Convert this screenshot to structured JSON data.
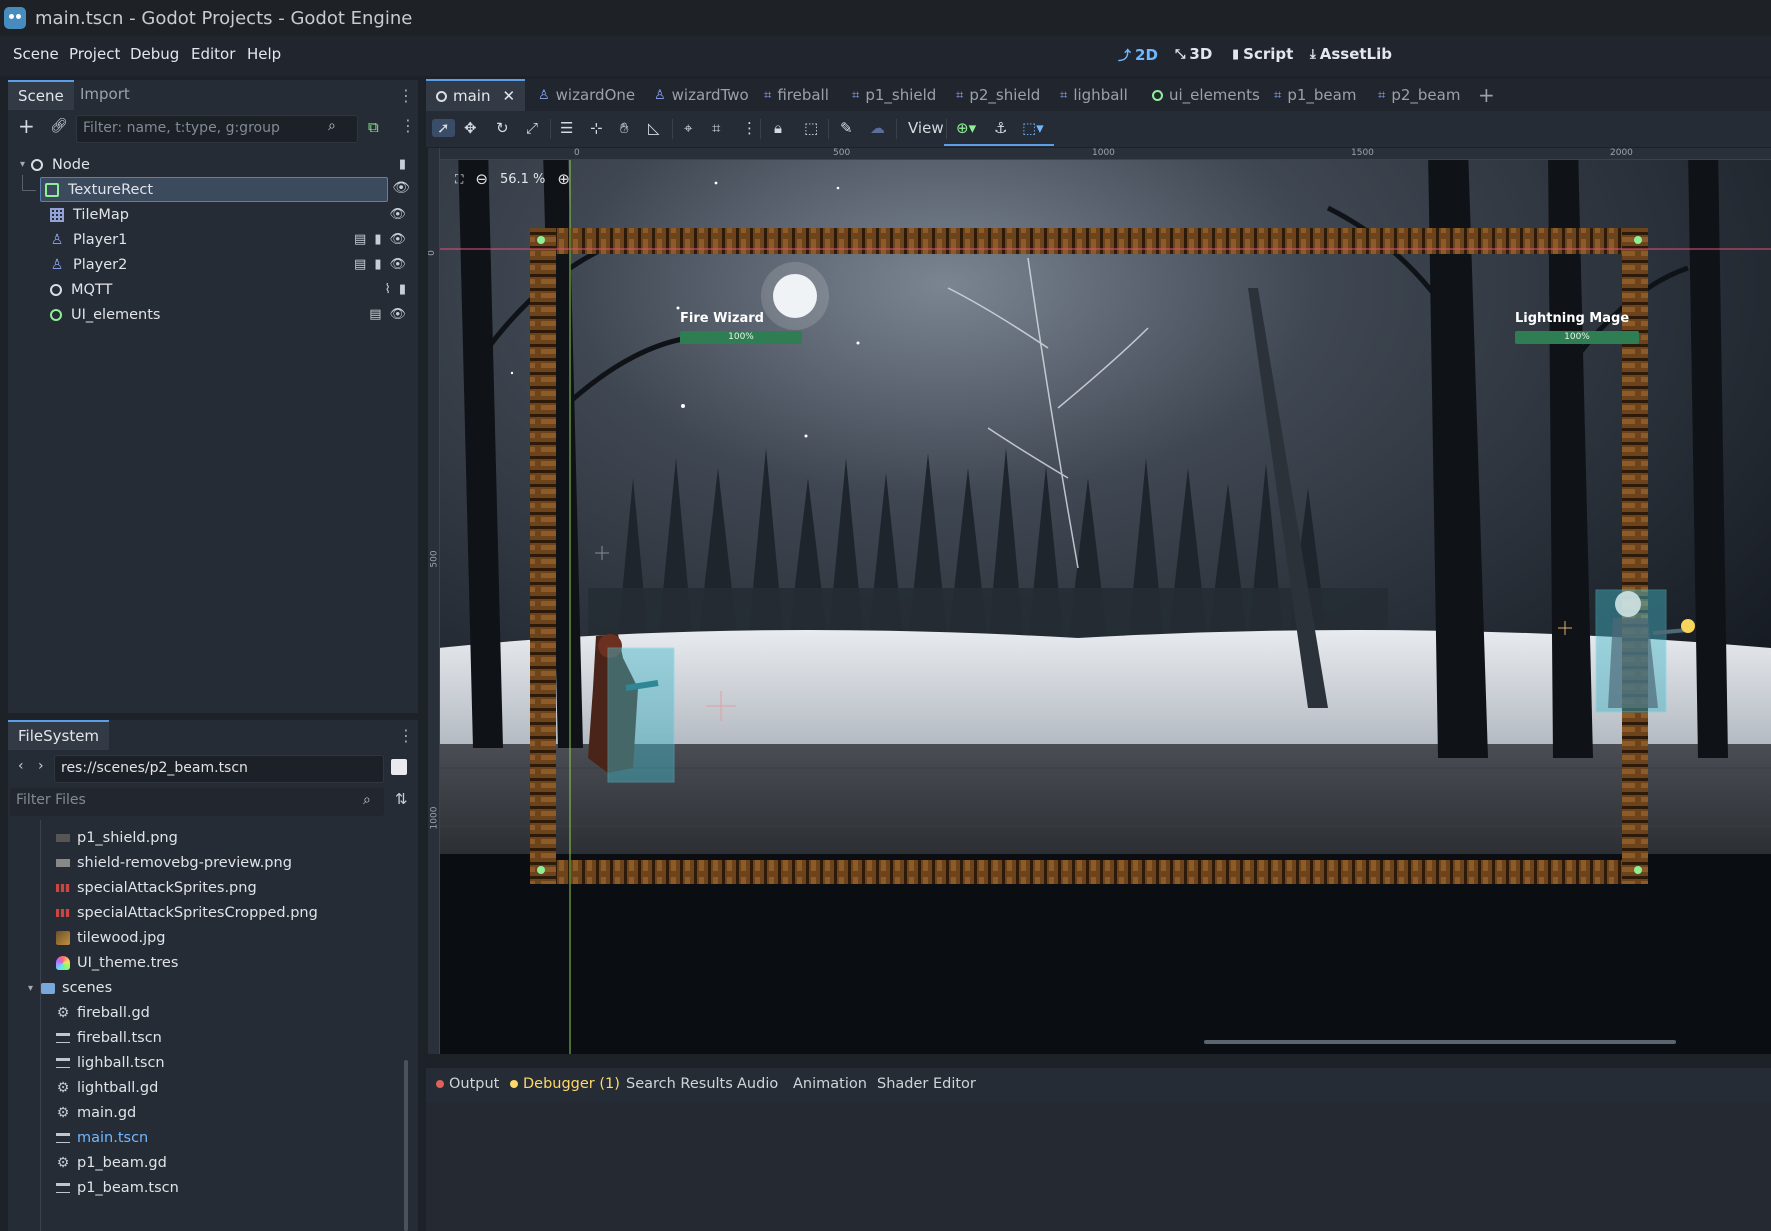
{
  "window": {
    "title": "main.tscn - Godot Projects - Godot Engine"
  },
  "menu": {
    "items": [
      "Scene",
      "Project",
      "Debug",
      "Editor",
      "Help"
    ]
  },
  "workspaces": [
    {
      "label": "2D",
      "icon": "2d-icon",
      "active": true
    },
    {
      "label": "3D",
      "icon": "3d-icon",
      "active": false
    },
    {
      "label": "Script",
      "icon": "script-icon",
      "active": false
    },
    {
      "label": "AssetLib",
      "icon": "assetlib-icon",
      "active": false
    }
  ],
  "scene_dock": {
    "tabs": [
      "Scene",
      "Import"
    ],
    "filter_placeholder": "Filter: name, t:type, g:group",
    "nodes": [
      {
        "name": "Node",
        "icon": "node-icon",
        "selected": false
      },
      {
        "name": "TextureRect",
        "icon": "texturerect-icon",
        "selected": true
      },
      {
        "name": "TileMap",
        "icon": "tilemap-icon",
        "selected": false
      },
      {
        "name": "Player1",
        "icon": "characterbody-icon",
        "selected": false
      },
      {
        "name": "Player2",
        "icon": "characterbody-icon",
        "selected": false
      },
      {
        "name": "MQTT",
        "icon": "node-icon",
        "selected": false
      },
      {
        "name": "UI_elements",
        "icon": "control-icon",
        "selected": false
      }
    ]
  },
  "filesystem": {
    "tab": "FileSystem",
    "path": "res://scenes/p2_beam.tscn",
    "filter_placeholder": "Filter Files",
    "items": [
      {
        "name": "p1_shield.png",
        "type": "image"
      },
      {
        "name": "shield-removebg-preview.png",
        "type": "image"
      },
      {
        "name": "specialAttackSprites.png",
        "type": "image"
      },
      {
        "name": "specialAttackSpritesCropped.png",
        "type": "image"
      },
      {
        "name": "tilewood.jpg",
        "type": "image"
      },
      {
        "name": "UI_theme.tres",
        "type": "theme"
      },
      {
        "name": "scenes",
        "type": "folder"
      },
      {
        "name": "fireball.gd",
        "type": "script"
      },
      {
        "name": "fireball.tscn",
        "type": "scene"
      },
      {
        "name": "lighball.tscn",
        "type": "scene"
      },
      {
        "name": "lightball.gd",
        "type": "script"
      },
      {
        "name": "main.gd",
        "type": "script"
      },
      {
        "name": "main.tscn",
        "type": "scene",
        "active": true
      },
      {
        "name": "p1_beam.gd",
        "type": "script"
      },
      {
        "name": "p1_beam.tscn",
        "type": "scene"
      }
    ]
  },
  "scene_tabs": [
    "main",
    "wizardOne",
    "wizardTwo",
    "fireball",
    "p1_shield",
    "p2_shield",
    "lighball",
    "ui_elements",
    "p1_beam",
    "p2_beam"
  ],
  "toolbar": {
    "view_label": "View"
  },
  "viewport": {
    "zoom": "56.1 %",
    "ruler_marks": [
      "0",
      "500",
      "1000",
      "1500",
      "2000"
    ],
    "ruler_marks_left": [
      "0",
      "500",
      "1000"
    ],
    "player1": {
      "name": "Fire Wizard",
      "health": "100%",
      "health_fraction": 1.0
    },
    "player2": {
      "name": "Lightning Mage",
      "health": "100%",
      "health_fraction": 1.0
    }
  },
  "bottom_panel": {
    "tabs": [
      {
        "label": "Output",
        "dot": "#e0605a"
      },
      {
        "label": "Debugger (1)",
        "dot": "#ffd86b",
        "warn": true
      },
      {
        "label": "Search Results"
      },
      {
        "label": "Audio"
      },
      {
        "label": "Animation"
      },
      {
        "label": "Shader Editor"
      }
    ]
  },
  "colors": {
    "accent": "#70b7ff",
    "health": "#2f7d52",
    "selection": "#3c4a5e"
  }
}
